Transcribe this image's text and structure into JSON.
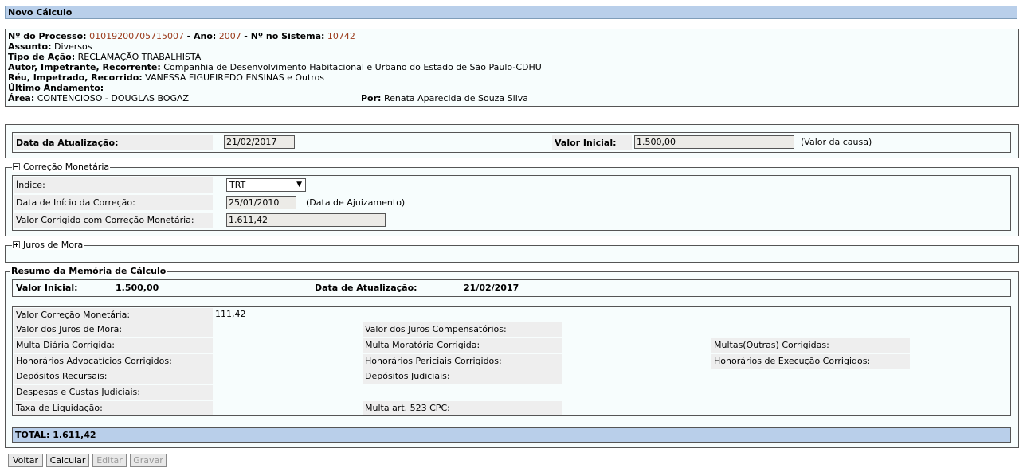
{
  "title": "Novo Cálculo",
  "processo": {
    "numero_label": "Nº do Processo:",
    "numero": "01019200705715007",
    "ano_label": "Ano:",
    "ano": "2007",
    "sistema_label": "Nº no Sistema:",
    "sistema": "10742",
    "assunto_label": "Assunto:",
    "assunto": "Diversos",
    "tipo_label": "Tipo de Ação:",
    "tipo": "RECLAMAÇÃO TRABALHISTA",
    "autor_label": "Autor, Impetrante, Recorrente:",
    "autor": "Companhia de Desenvolvimento Habitacional e Urbano do Estado de São Paulo-CDHU",
    "reu_label": "Réu, Impetrado, Recorrido:",
    "reu": "VANESSA FIGUEIREDO ENSINAS e Outros",
    "andamento_label": "Último Andamento:",
    "area_label": "Área:",
    "area": "CONTENCIOSO - DOUGLAS BOGAZ",
    "por_label": "Por:",
    "por": "Renata Aparecida de Souza Silva"
  },
  "atualizacao": {
    "data_label": "Data da Atualização:",
    "data_value": "21/02/2017",
    "valor_label": "Valor Inicial:",
    "valor_value": "1.500,00",
    "valor_note": "(Valor da causa)"
  },
  "correcao": {
    "legend": "Correção Monetária",
    "indice_label": "Índice:",
    "indice_value": "TRT",
    "inicio_label": "Data de Início da Correção:",
    "inicio_value": "25/01/2010",
    "inicio_note": "(Data de Ajuizamento)",
    "corrigido_label": "Valor Corrigido com Correção Monetária:",
    "corrigido_value": "1.611,42"
  },
  "juros": {
    "legend": "Juros de Mora"
  },
  "resumo": {
    "legend": "Resumo da Memória de Cálculo",
    "valor_inicial_label": "Valor Inicial:",
    "valor_inicial": "1.500,00",
    "data_label": "Data de Atualização:",
    "data": "21/02/2017",
    "correcao_label": "Valor Correção Monetária:",
    "correcao_value": "111,42",
    "juros_mora": "Valor dos Juros de Mora:",
    "multa_diaria": "Multa Diária Corrigida:",
    "honorarios_adv": "Honorários Advocatícios Corrigidos:",
    "depositos_recursais": "Depósitos Recursais:",
    "despesas": "Despesas e Custas Judiciais:",
    "taxa": "Taxa de Liquidação:",
    "juros_comp": "Valor dos Juros Compensatórios:",
    "multa_moratoria": "Multa Moratória Corrigida:",
    "honorarios_per": "Honorários Periciais Corrigidos:",
    "depositos_judiciais": "Depósitos Judiciais:",
    "multa_523": "Multa art. 523 CPC:",
    "multas_outras": "Multas(Outras) Corrigidas:",
    "honorarios_exec": "Honorários de Execução Corrigidos:",
    "total": "TOTAL: 1.611,42"
  },
  "buttons": {
    "voltar": "Voltar",
    "calcular": "Calcular",
    "editar": "Editar",
    "gravar": "Gravar"
  }
}
